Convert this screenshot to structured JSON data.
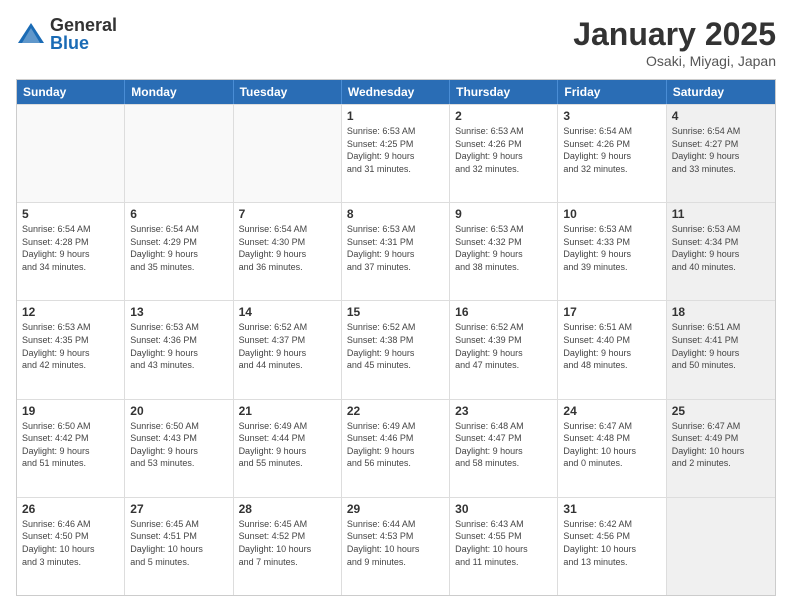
{
  "header": {
    "logo_general": "General",
    "logo_blue": "Blue",
    "month_title": "January 2025",
    "subtitle": "Osaki, Miyagi, Japan"
  },
  "weekdays": [
    "Sunday",
    "Monday",
    "Tuesday",
    "Wednesday",
    "Thursday",
    "Friday",
    "Saturday"
  ],
  "rows": [
    [
      {
        "day": "",
        "info": "",
        "empty": true
      },
      {
        "day": "",
        "info": "",
        "empty": true
      },
      {
        "day": "",
        "info": "",
        "empty": true
      },
      {
        "day": "1",
        "info": "Sunrise: 6:53 AM\nSunset: 4:25 PM\nDaylight: 9 hours\nand 31 minutes."
      },
      {
        "day": "2",
        "info": "Sunrise: 6:53 AM\nSunset: 4:26 PM\nDaylight: 9 hours\nand 32 minutes."
      },
      {
        "day": "3",
        "info": "Sunrise: 6:54 AM\nSunset: 4:26 PM\nDaylight: 9 hours\nand 32 minutes."
      },
      {
        "day": "4",
        "info": "Sunrise: 6:54 AM\nSunset: 4:27 PM\nDaylight: 9 hours\nand 33 minutes.",
        "shaded": true
      }
    ],
    [
      {
        "day": "5",
        "info": "Sunrise: 6:54 AM\nSunset: 4:28 PM\nDaylight: 9 hours\nand 34 minutes."
      },
      {
        "day": "6",
        "info": "Sunrise: 6:54 AM\nSunset: 4:29 PM\nDaylight: 9 hours\nand 35 minutes."
      },
      {
        "day": "7",
        "info": "Sunrise: 6:54 AM\nSunset: 4:30 PM\nDaylight: 9 hours\nand 36 minutes."
      },
      {
        "day": "8",
        "info": "Sunrise: 6:53 AM\nSunset: 4:31 PM\nDaylight: 9 hours\nand 37 minutes."
      },
      {
        "day": "9",
        "info": "Sunrise: 6:53 AM\nSunset: 4:32 PM\nDaylight: 9 hours\nand 38 minutes."
      },
      {
        "day": "10",
        "info": "Sunrise: 6:53 AM\nSunset: 4:33 PM\nDaylight: 9 hours\nand 39 minutes."
      },
      {
        "day": "11",
        "info": "Sunrise: 6:53 AM\nSunset: 4:34 PM\nDaylight: 9 hours\nand 40 minutes.",
        "shaded": true
      }
    ],
    [
      {
        "day": "12",
        "info": "Sunrise: 6:53 AM\nSunset: 4:35 PM\nDaylight: 9 hours\nand 42 minutes."
      },
      {
        "day": "13",
        "info": "Sunrise: 6:53 AM\nSunset: 4:36 PM\nDaylight: 9 hours\nand 43 minutes."
      },
      {
        "day": "14",
        "info": "Sunrise: 6:52 AM\nSunset: 4:37 PM\nDaylight: 9 hours\nand 44 minutes."
      },
      {
        "day": "15",
        "info": "Sunrise: 6:52 AM\nSunset: 4:38 PM\nDaylight: 9 hours\nand 45 minutes."
      },
      {
        "day": "16",
        "info": "Sunrise: 6:52 AM\nSunset: 4:39 PM\nDaylight: 9 hours\nand 47 minutes."
      },
      {
        "day": "17",
        "info": "Sunrise: 6:51 AM\nSunset: 4:40 PM\nDaylight: 9 hours\nand 48 minutes."
      },
      {
        "day": "18",
        "info": "Sunrise: 6:51 AM\nSunset: 4:41 PM\nDaylight: 9 hours\nand 50 minutes.",
        "shaded": true
      }
    ],
    [
      {
        "day": "19",
        "info": "Sunrise: 6:50 AM\nSunset: 4:42 PM\nDaylight: 9 hours\nand 51 minutes."
      },
      {
        "day": "20",
        "info": "Sunrise: 6:50 AM\nSunset: 4:43 PM\nDaylight: 9 hours\nand 53 minutes."
      },
      {
        "day": "21",
        "info": "Sunrise: 6:49 AM\nSunset: 4:44 PM\nDaylight: 9 hours\nand 55 minutes."
      },
      {
        "day": "22",
        "info": "Sunrise: 6:49 AM\nSunset: 4:46 PM\nDaylight: 9 hours\nand 56 minutes."
      },
      {
        "day": "23",
        "info": "Sunrise: 6:48 AM\nSunset: 4:47 PM\nDaylight: 9 hours\nand 58 minutes."
      },
      {
        "day": "24",
        "info": "Sunrise: 6:47 AM\nSunset: 4:48 PM\nDaylight: 10 hours\nand 0 minutes."
      },
      {
        "day": "25",
        "info": "Sunrise: 6:47 AM\nSunset: 4:49 PM\nDaylight: 10 hours\nand 2 minutes.",
        "shaded": true
      }
    ],
    [
      {
        "day": "26",
        "info": "Sunrise: 6:46 AM\nSunset: 4:50 PM\nDaylight: 10 hours\nand 3 minutes."
      },
      {
        "day": "27",
        "info": "Sunrise: 6:45 AM\nSunset: 4:51 PM\nDaylight: 10 hours\nand 5 minutes."
      },
      {
        "day": "28",
        "info": "Sunrise: 6:45 AM\nSunset: 4:52 PM\nDaylight: 10 hours\nand 7 minutes."
      },
      {
        "day": "29",
        "info": "Sunrise: 6:44 AM\nSunset: 4:53 PM\nDaylight: 10 hours\nand 9 minutes."
      },
      {
        "day": "30",
        "info": "Sunrise: 6:43 AM\nSunset: 4:55 PM\nDaylight: 10 hours\nand 11 minutes."
      },
      {
        "day": "31",
        "info": "Sunrise: 6:42 AM\nSunset: 4:56 PM\nDaylight: 10 hours\nand 13 minutes."
      },
      {
        "day": "",
        "info": "",
        "empty": true,
        "shaded": true
      }
    ]
  ]
}
